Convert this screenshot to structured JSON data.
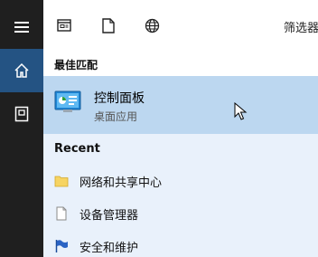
{
  "toolbar": {
    "filter_label": "筛选器"
  },
  "best_match": {
    "header": "最佳匹配",
    "title": "控制面板",
    "subtitle": "桌面应用"
  },
  "recent": {
    "header": "Recent",
    "items": [
      {
        "label": "网络和共享中心",
        "icon": "folder-icon"
      },
      {
        "label": "设备管理器",
        "icon": "document-icon"
      },
      {
        "label": "安全和维护",
        "icon": "flag-icon"
      }
    ]
  },
  "colors": {
    "rail_bg": "#1f1f1f",
    "rail_selected": "#245383",
    "highlight": "#bcd7f0",
    "panel_bg": "#e9f1fb"
  }
}
